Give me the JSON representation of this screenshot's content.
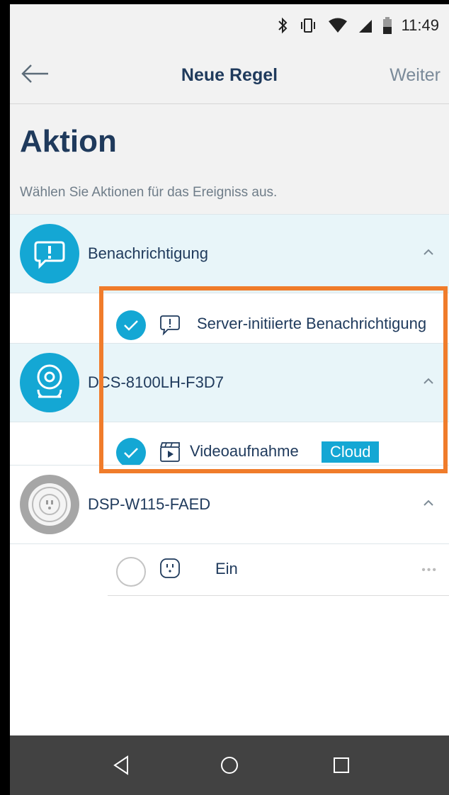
{
  "status": {
    "time": "11:49",
    "icons": [
      "bluetooth-icon",
      "vibrate-icon",
      "wifi-icon",
      "signal-icon",
      "battery-icon"
    ]
  },
  "nav": {
    "title": "Neue Regel",
    "next_label": "Weiter",
    "back_icon": "arrow-left-icon"
  },
  "header": {
    "title": "Aktion",
    "subtitle": "Wählen Sie Aktionen für das Ereigniss aus."
  },
  "groups": [
    {
      "label": "Benachrichtigung",
      "icon": "notification-icon",
      "action": {
        "label": "Server-initiierte Benachrichtigung",
        "checked": true,
        "icon": "notification-bubble-icon"
      }
    },
    {
      "label": "DCS-8100LH-F3D7",
      "icon": "camera-icon",
      "action": {
        "label": "Videoaufnahme",
        "badge": "Cloud",
        "checked": true,
        "icon": "video-clip-icon"
      }
    },
    {
      "label": "DSP-W115-FAED",
      "icon": "smart-plug-icon",
      "action": {
        "label": "Ein",
        "checked": false,
        "icon": "plug-icon"
      }
    }
  ],
  "colors": {
    "accent": "#14a7d4",
    "highlight": "#f07c2b",
    "title": "#1f3a5c"
  }
}
